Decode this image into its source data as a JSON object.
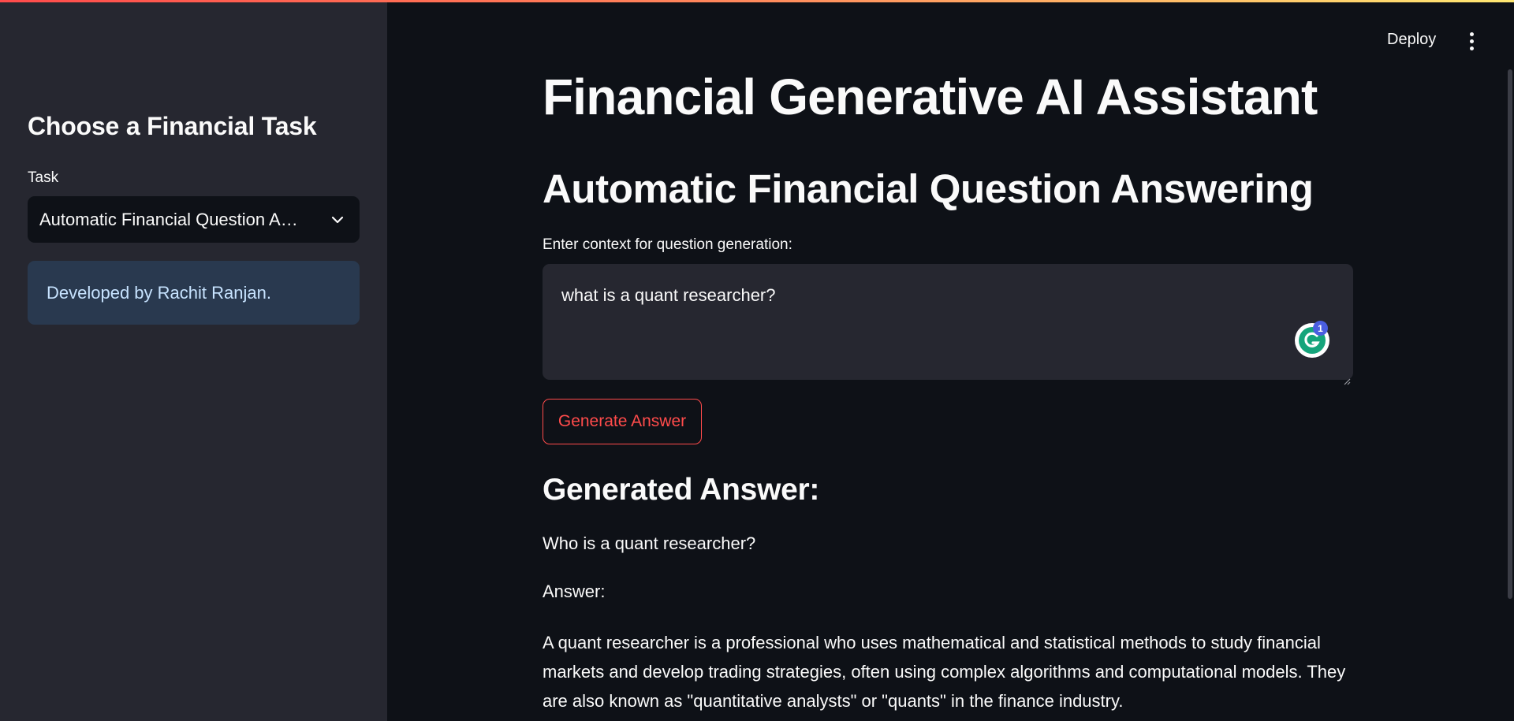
{
  "sidebar": {
    "title": "Choose a Financial Task",
    "task_label": "Task",
    "task_selected": "Automatic Financial Question An…",
    "info": "Developed by Rachit Ranjan."
  },
  "header": {
    "deploy_label": "Deploy",
    "menu_icon": "more-vertical-icon"
  },
  "main": {
    "title": "Financial Generative AI Assistant",
    "subheader": "Automatic Financial Question Answering",
    "context_label": "Enter context for question generation:",
    "context_value": "what is a quant researcher?",
    "grammarly_count": "1",
    "generate_label": "Generate Answer",
    "answer_heading": "Generated Answer:",
    "answer_question": "Who is a quant researcher?",
    "answer_label": "Answer:",
    "answer_body": "A quant researcher is a professional who uses mathematical and statistical methods to study financial markets and develop trading strategies, often using complex algorithms and computational models. They are also known as \"quantitative analysts\" or \"quants\" in the finance industry."
  },
  "colors": {
    "accent": "#ff4b4b",
    "background": "#0e1117",
    "sidebar": "#262730",
    "info_box": "#29394f",
    "info_text": "#c7e3ff"
  }
}
